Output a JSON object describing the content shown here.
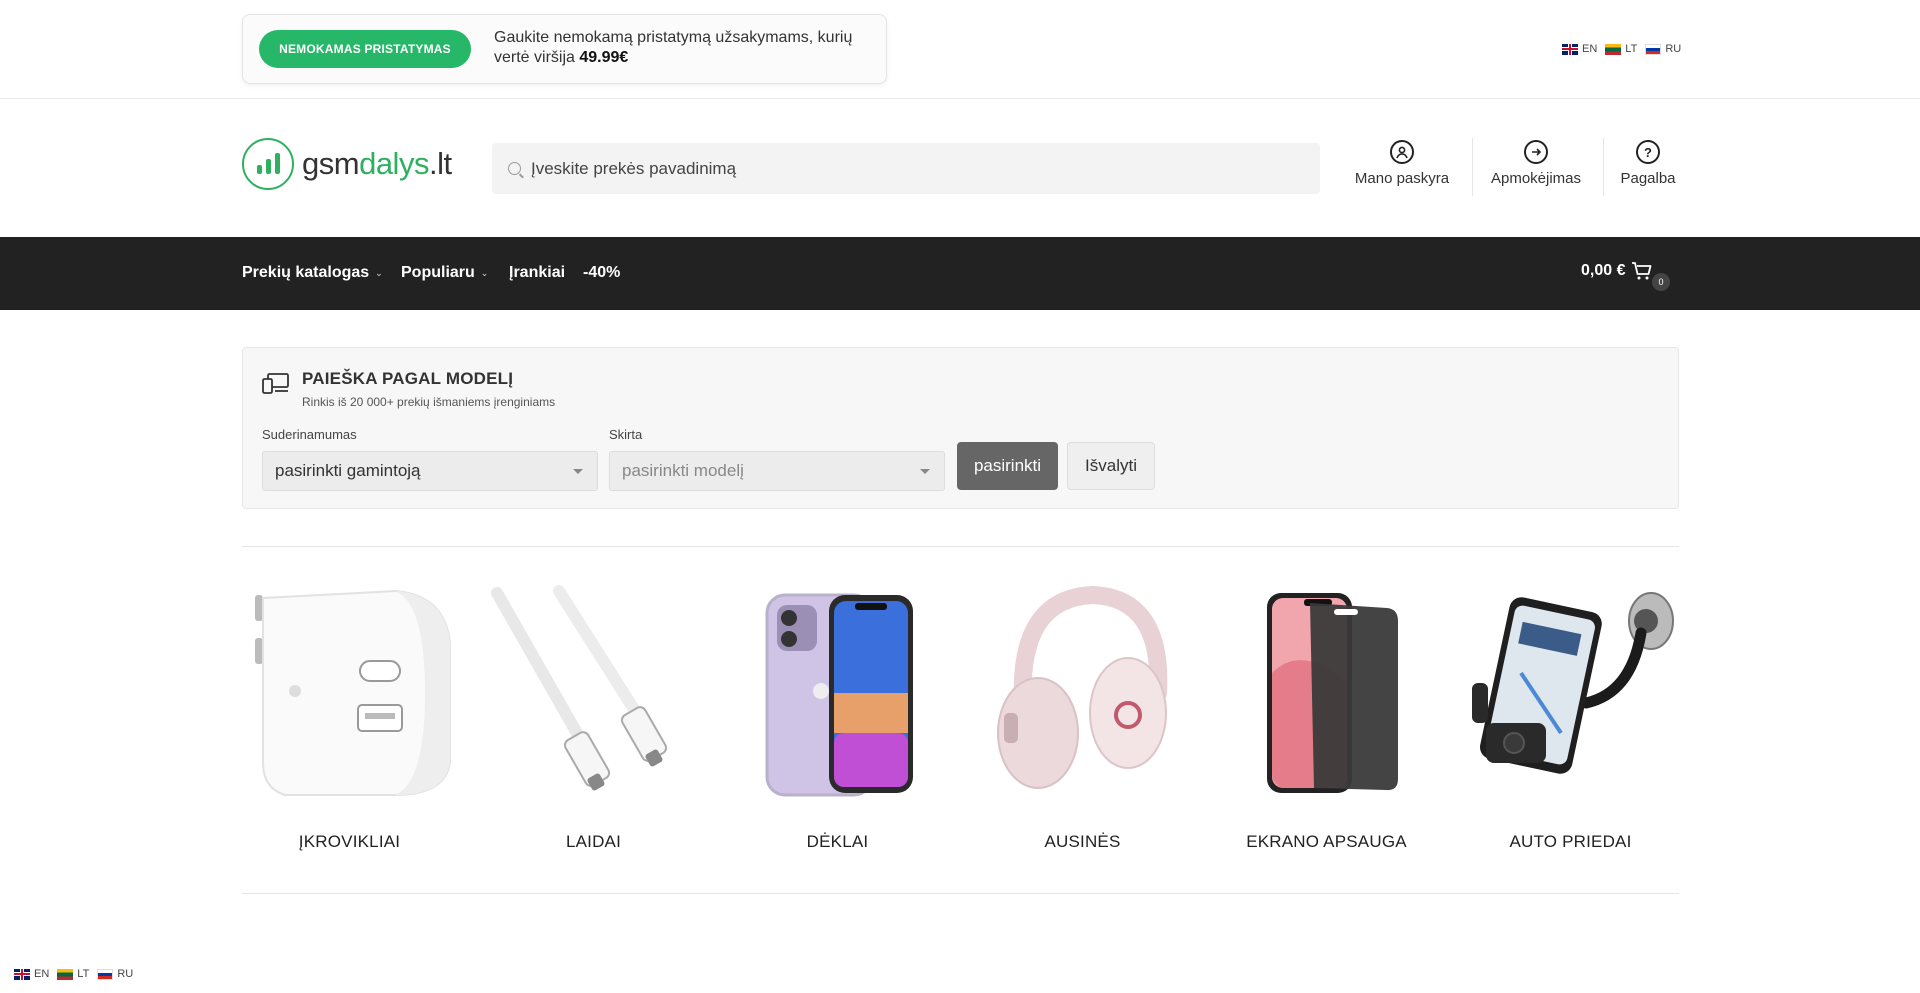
{
  "promo": {
    "badge": " NEMOKAMAS PRISTATYMAS",
    "text": "Gaukite nemokamą pristatymą užsakymams, kurių vertė viršija ",
    "amount": "49.99€"
  },
  "languages": [
    {
      "code": "EN"
    },
    {
      "code": "LT"
    },
    {
      "code": "RU"
    }
  ],
  "logo": {
    "part1": "gsm",
    "part2": "dalys",
    "part3": ".lt"
  },
  "search": {
    "placeholder": "Įveskite prekės pavadinimą"
  },
  "header_links": {
    "account": "Mano paskyra",
    "checkout": "Apmokėjimas",
    "help": "Pagalba"
  },
  "nav": {
    "catalog": "Prekių katalogas",
    "popular": "Populiaru",
    "tools": "Įrankiai",
    "sale": "-40%",
    "cart_total": "0,00 €",
    "cart_count": "0"
  },
  "model_search": {
    "title": "PAIEŠKA PAGAL MODELĮ",
    "subtitle": "Rinkis iš 20 000+ prekių išmaniems įrenginiams",
    "compat_label": "Suderinamumas",
    "compat_value": "pasirinkti gamintoją",
    "model_label": "Skirta",
    "model_value": "pasirinkti modelį",
    "select_button": "pasirinkti",
    "clear_button": "Išvalyti"
  },
  "categories": [
    {
      "label": "ĮKROVIKLIAI"
    },
    {
      "label": "LAIDAI"
    },
    {
      "label": "DĖKLAI"
    },
    {
      "label": "AUSINĖS"
    },
    {
      "label": "EKRANO APSAUGA"
    },
    {
      "label": "AUTO PRIEDAI"
    }
  ],
  "colors": {
    "accent_green": "#26b868",
    "nav_bg": "#222222",
    "button_primary": "#666666"
  }
}
